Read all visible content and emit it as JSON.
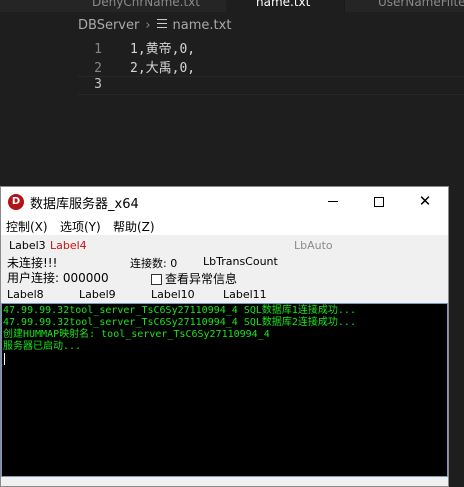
{
  "editor": {
    "tabs": [
      "DenyChrName.txt",
      "name.txt",
      "UserNameFilter"
    ],
    "breadcrumb": {
      "folder": "DBServer",
      "file": "name.txt"
    },
    "lines": [
      {
        "num": "1",
        "text": "1,黄帝,0,"
      },
      {
        "num": "2",
        "text": "2,大禹,0,"
      },
      {
        "num": "3",
        "text": ""
      }
    ]
  },
  "window": {
    "icon_letter": "D",
    "title": "数据库服务器_x64",
    "controls": {
      "minimize": "minimize-icon",
      "maximize": "maximize-icon",
      "close": "✕"
    },
    "menu": [
      "控制(X)",
      "选项(Y)",
      "帮助(Z)"
    ],
    "labels": {
      "label3": "Label3",
      "label4": "Label4",
      "lbauto": "LbAuto",
      "not_connected": "未连接!!!",
      "connect_count": "连接数: 0",
      "lb_trans_count": "LbTransCount",
      "user_connect": "用户连接: 000000",
      "check_exceptions": "查看异常信息",
      "label8": "Label8",
      "label9": "Label9",
      "label10": "Label10",
      "label11": "Label11"
    },
    "console_lines": [
      "47.99.99.32tool_server_TsC6Sy27110994_4 SQL数据库1连接成功...",
      "47.99.99.32tool_server_TsC6Sy27110994_4 SQL数据库2连接成功...",
      "创建HUMMAP映射名: tool_server_TsC6Sy27110994_4",
      "服务器已启动..."
    ]
  },
  "colors": {
    "editor_bg": "#1e1e1e",
    "console_text": "#17e617",
    "label4_red": "#d01010",
    "app_icon_red": "#b31217"
  }
}
